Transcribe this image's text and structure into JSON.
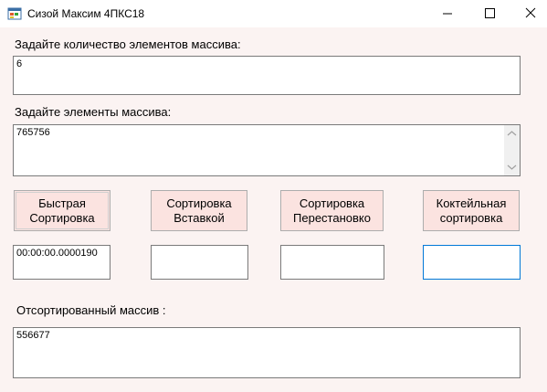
{
  "window": {
    "title": "Сизой Максим 4ПКС18",
    "icon": "windows-form-icon",
    "controls": [
      "minimize-icon",
      "maximize-icon",
      "close-icon"
    ]
  },
  "form": {
    "count_label": "Задайте количество элементов массива:",
    "count_value": "6",
    "elements_label": "Задайте элементы массива:",
    "elements_value": "765756",
    "buttons": [
      {
        "line1": "Быстрая",
        "line2": "Сортировка"
      },
      {
        "line1": "Сортировка",
        "line2": "Вставкой"
      },
      {
        "line1": "Сортировка",
        "line2": "Перестановко"
      },
      {
        "line1": "Коктейльная",
        "line2": "сортировка"
      }
    ],
    "times": [
      "00:00:00.0000190",
      "",
      "",
      ""
    ],
    "sorted_label": "Отсортированный массив :",
    "sorted_value": "556677"
  }
}
